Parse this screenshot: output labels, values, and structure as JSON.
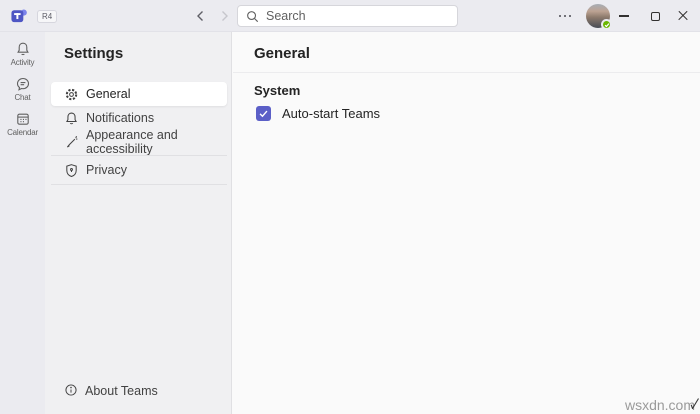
{
  "titlebar": {
    "ring_badge": "R4",
    "search_placeholder": "Search"
  },
  "rail": {
    "items": [
      {
        "label": "Activity",
        "icon": "bell-icon"
      },
      {
        "label": "Chat",
        "icon": "chat-icon"
      },
      {
        "label": "Calendar",
        "icon": "calendar-icon"
      }
    ]
  },
  "sidebar": {
    "title": "Settings",
    "items": [
      {
        "label": "General",
        "icon": "gear-icon",
        "selected": true
      },
      {
        "label": "Notifications",
        "icon": "bell-icon",
        "selected": false
      },
      {
        "label": "Appearance and accessibility",
        "icon": "wand-icon",
        "selected": false
      },
      {
        "label": "Privacy",
        "icon": "shield-icon",
        "selected": false
      }
    ],
    "footer_label": "About Teams"
  },
  "main": {
    "title": "General",
    "system": {
      "heading": "System",
      "autostart": {
        "label": "Auto-start Teams",
        "checked": true
      }
    }
  },
  "watermark": "wsxdn.com",
  "icons": {
    "search": "magnifier",
    "more": "three-dots",
    "window": [
      "minimize",
      "maximize",
      "close"
    ],
    "presence": "available-check"
  },
  "colors": {
    "accent": "#5b5fc7",
    "presence_green": "#6bb700",
    "titlebar_bg": "#ebebf0",
    "sidebar_bg": "#f0f0f2",
    "main_bg": "#fafafa"
  }
}
